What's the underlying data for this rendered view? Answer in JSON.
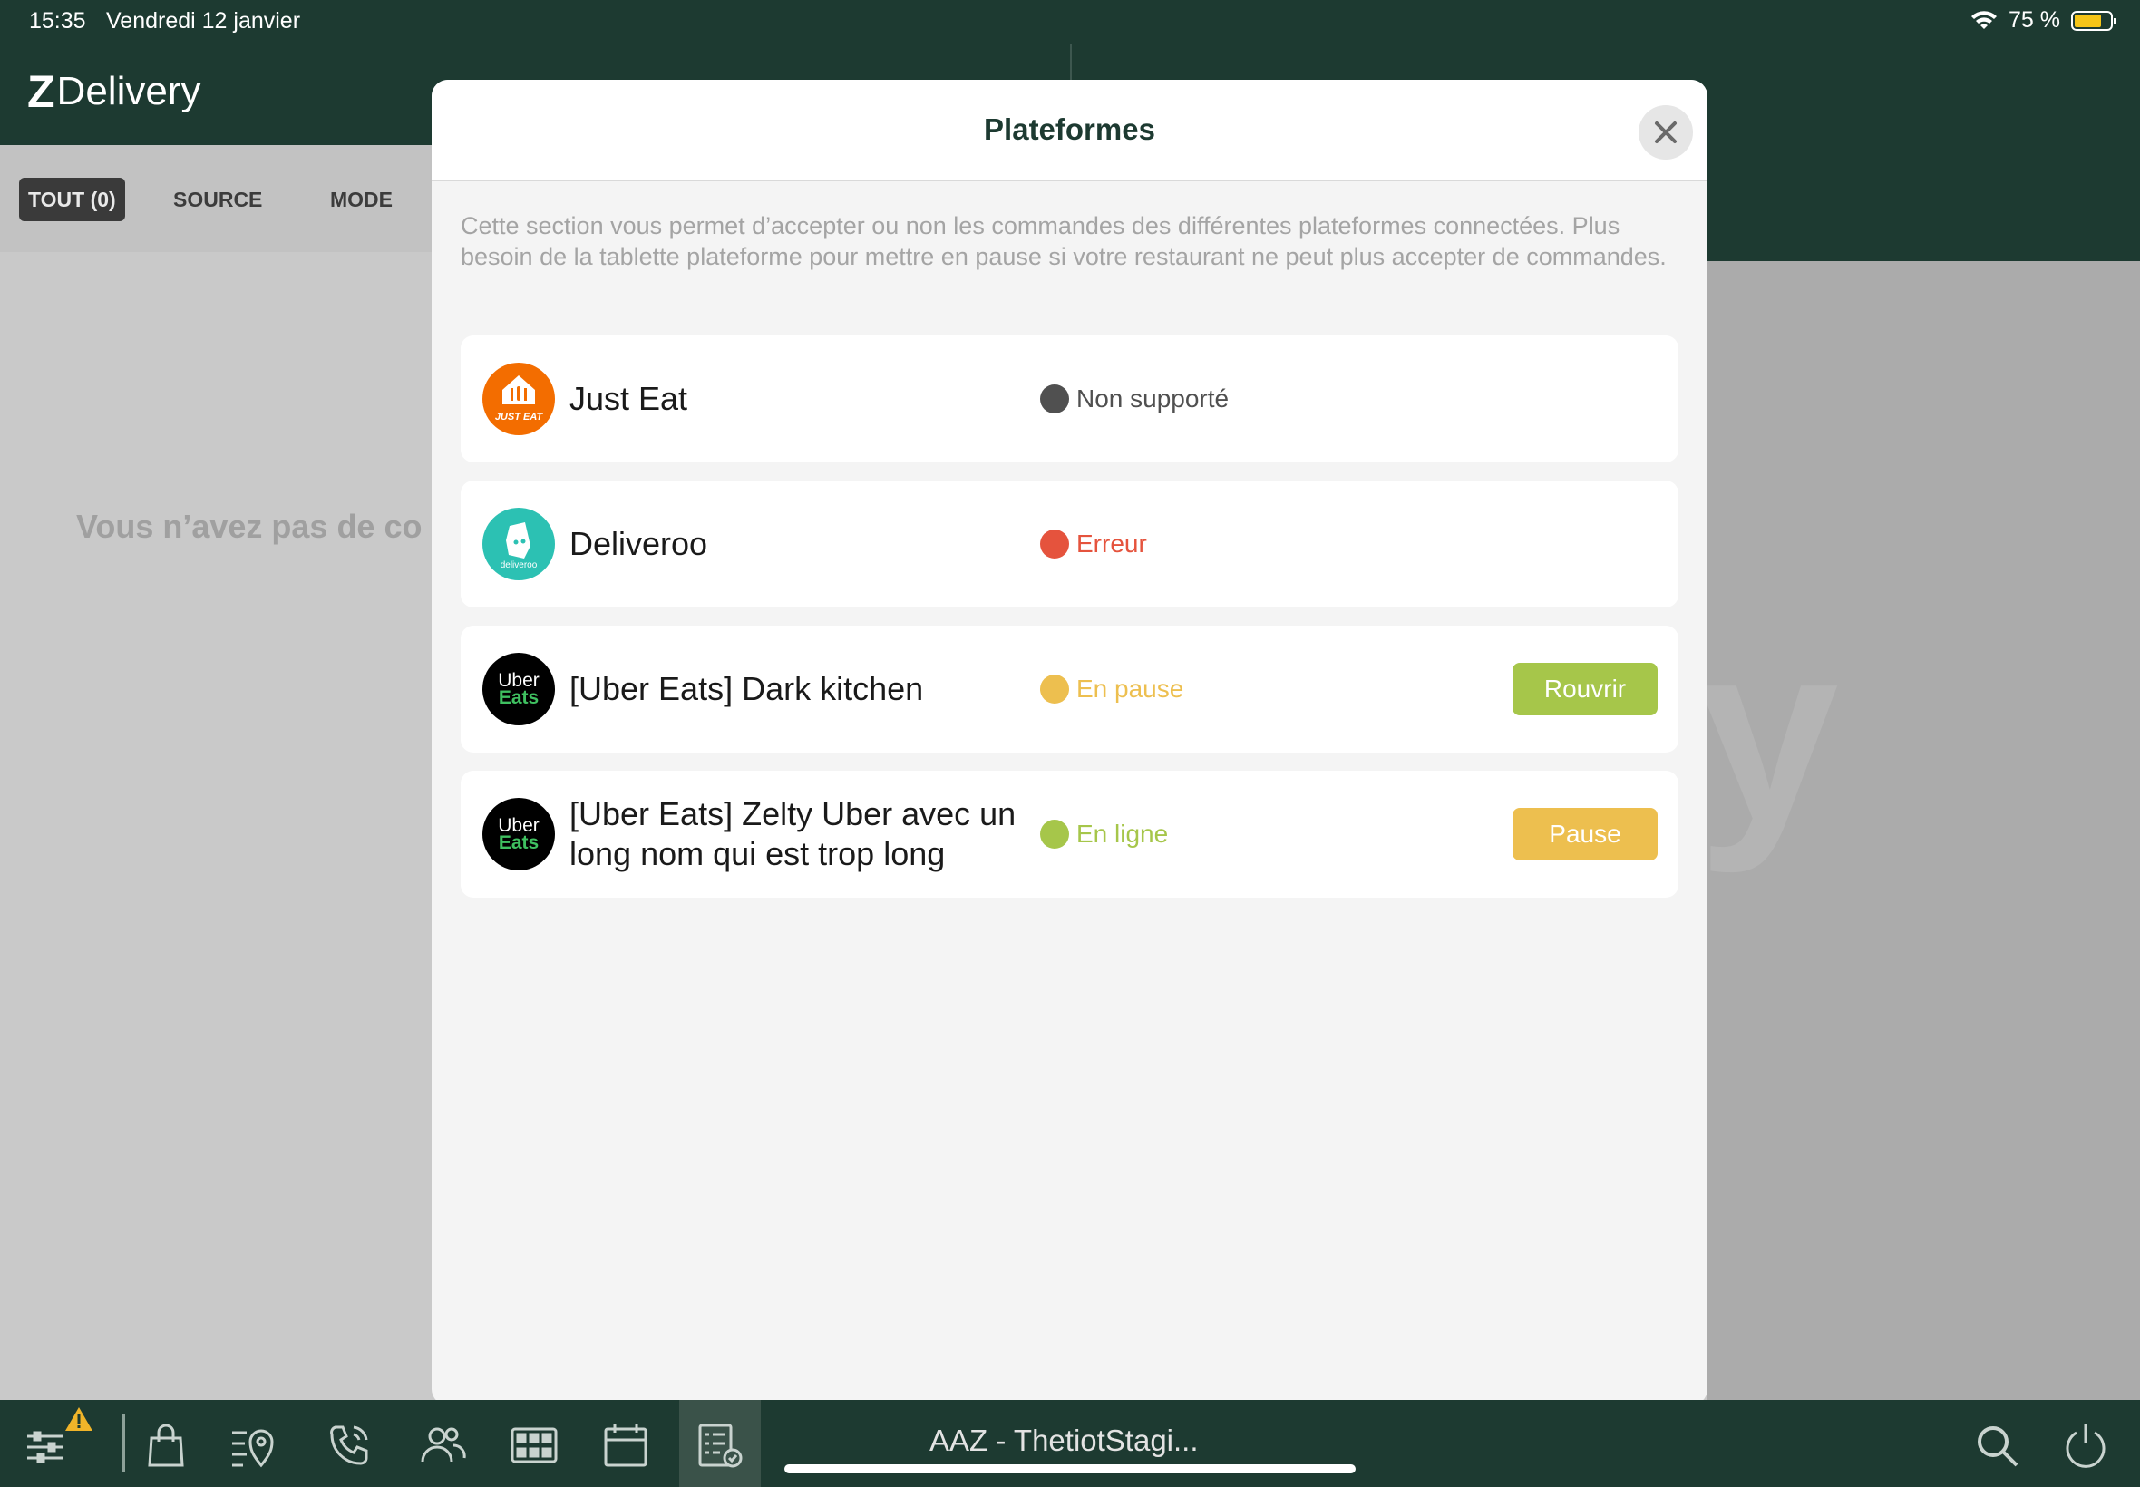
{
  "status_bar": {
    "time": "15:35",
    "date": "Vendredi 12 janvier",
    "battery": "75 %",
    "battery_level": 0.75
  },
  "app": {
    "logo_letter": "Z",
    "logo_text": "Delivery"
  },
  "filters": [
    {
      "label": "TOUT (0)",
      "active": true
    },
    {
      "label": "SOURCE",
      "active": false
    },
    {
      "label": "MODE",
      "active": false
    }
  ],
  "empty_message": "Vous n’avez pas de co",
  "watermark": "y",
  "modal": {
    "title": "Plateformes",
    "description": "Cette section vous permet d’accepter ou non les commandes des différentes plateformes connectées. Plus besoin de la tablette plateforme pour mettre en pause si votre restaurant ne peut plus accepter de commandes.",
    "platforms": [
      {
        "name": "Just Eat",
        "logo": "just-eat-logo",
        "logo_text": "JUST EAT",
        "status": "Non supporté",
        "status_color": "#505050",
        "dot_color": "#505050"
      },
      {
        "name": "Deliveroo",
        "logo": "deliveroo-logo",
        "logo_text": "deliveroo",
        "status": "Erreur",
        "status_color": "#e5533d",
        "dot_color": "#e5533d"
      },
      {
        "name": "[Uber Eats] Dark kitchen",
        "logo": "uber-eats-logo",
        "logo_top": "Uber",
        "logo_bottom": "Eats",
        "status": "En pause",
        "status_color": "#edbf4f",
        "dot_color": "#edbf4f",
        "action": "Rouvrir",
        "action_color": "#a6c64a"
      },
      {
        "name": "[Uber Eats] Zelty Uber avec un long nom qui est trop long",
        "logo": "uber-eats-logo",
        "logo_top": "Uber",
        "logo_bottom": "Eats",
        "status": "En ligne",
        "status_color": "#a6c64a",
        "dot_color": "#a6c64a",
        "action": "Pause",
        "action_color": "#edbf4f"
      }
    ]
  },
  "toolbar": {
    "title": "AAZ - ThetiotStagi...",
    "icons": [
      "settings-sliders-icon",
      "warning-icon",
      "shopping-bag-icon",
      "list-location-icon",
      "phone-icon",
      "users-icon",
      "grid-icon",
      "calendar-icon",
      "checklist-icon",
      "search-icon",
      "power-icon"
    ]
  }
}
